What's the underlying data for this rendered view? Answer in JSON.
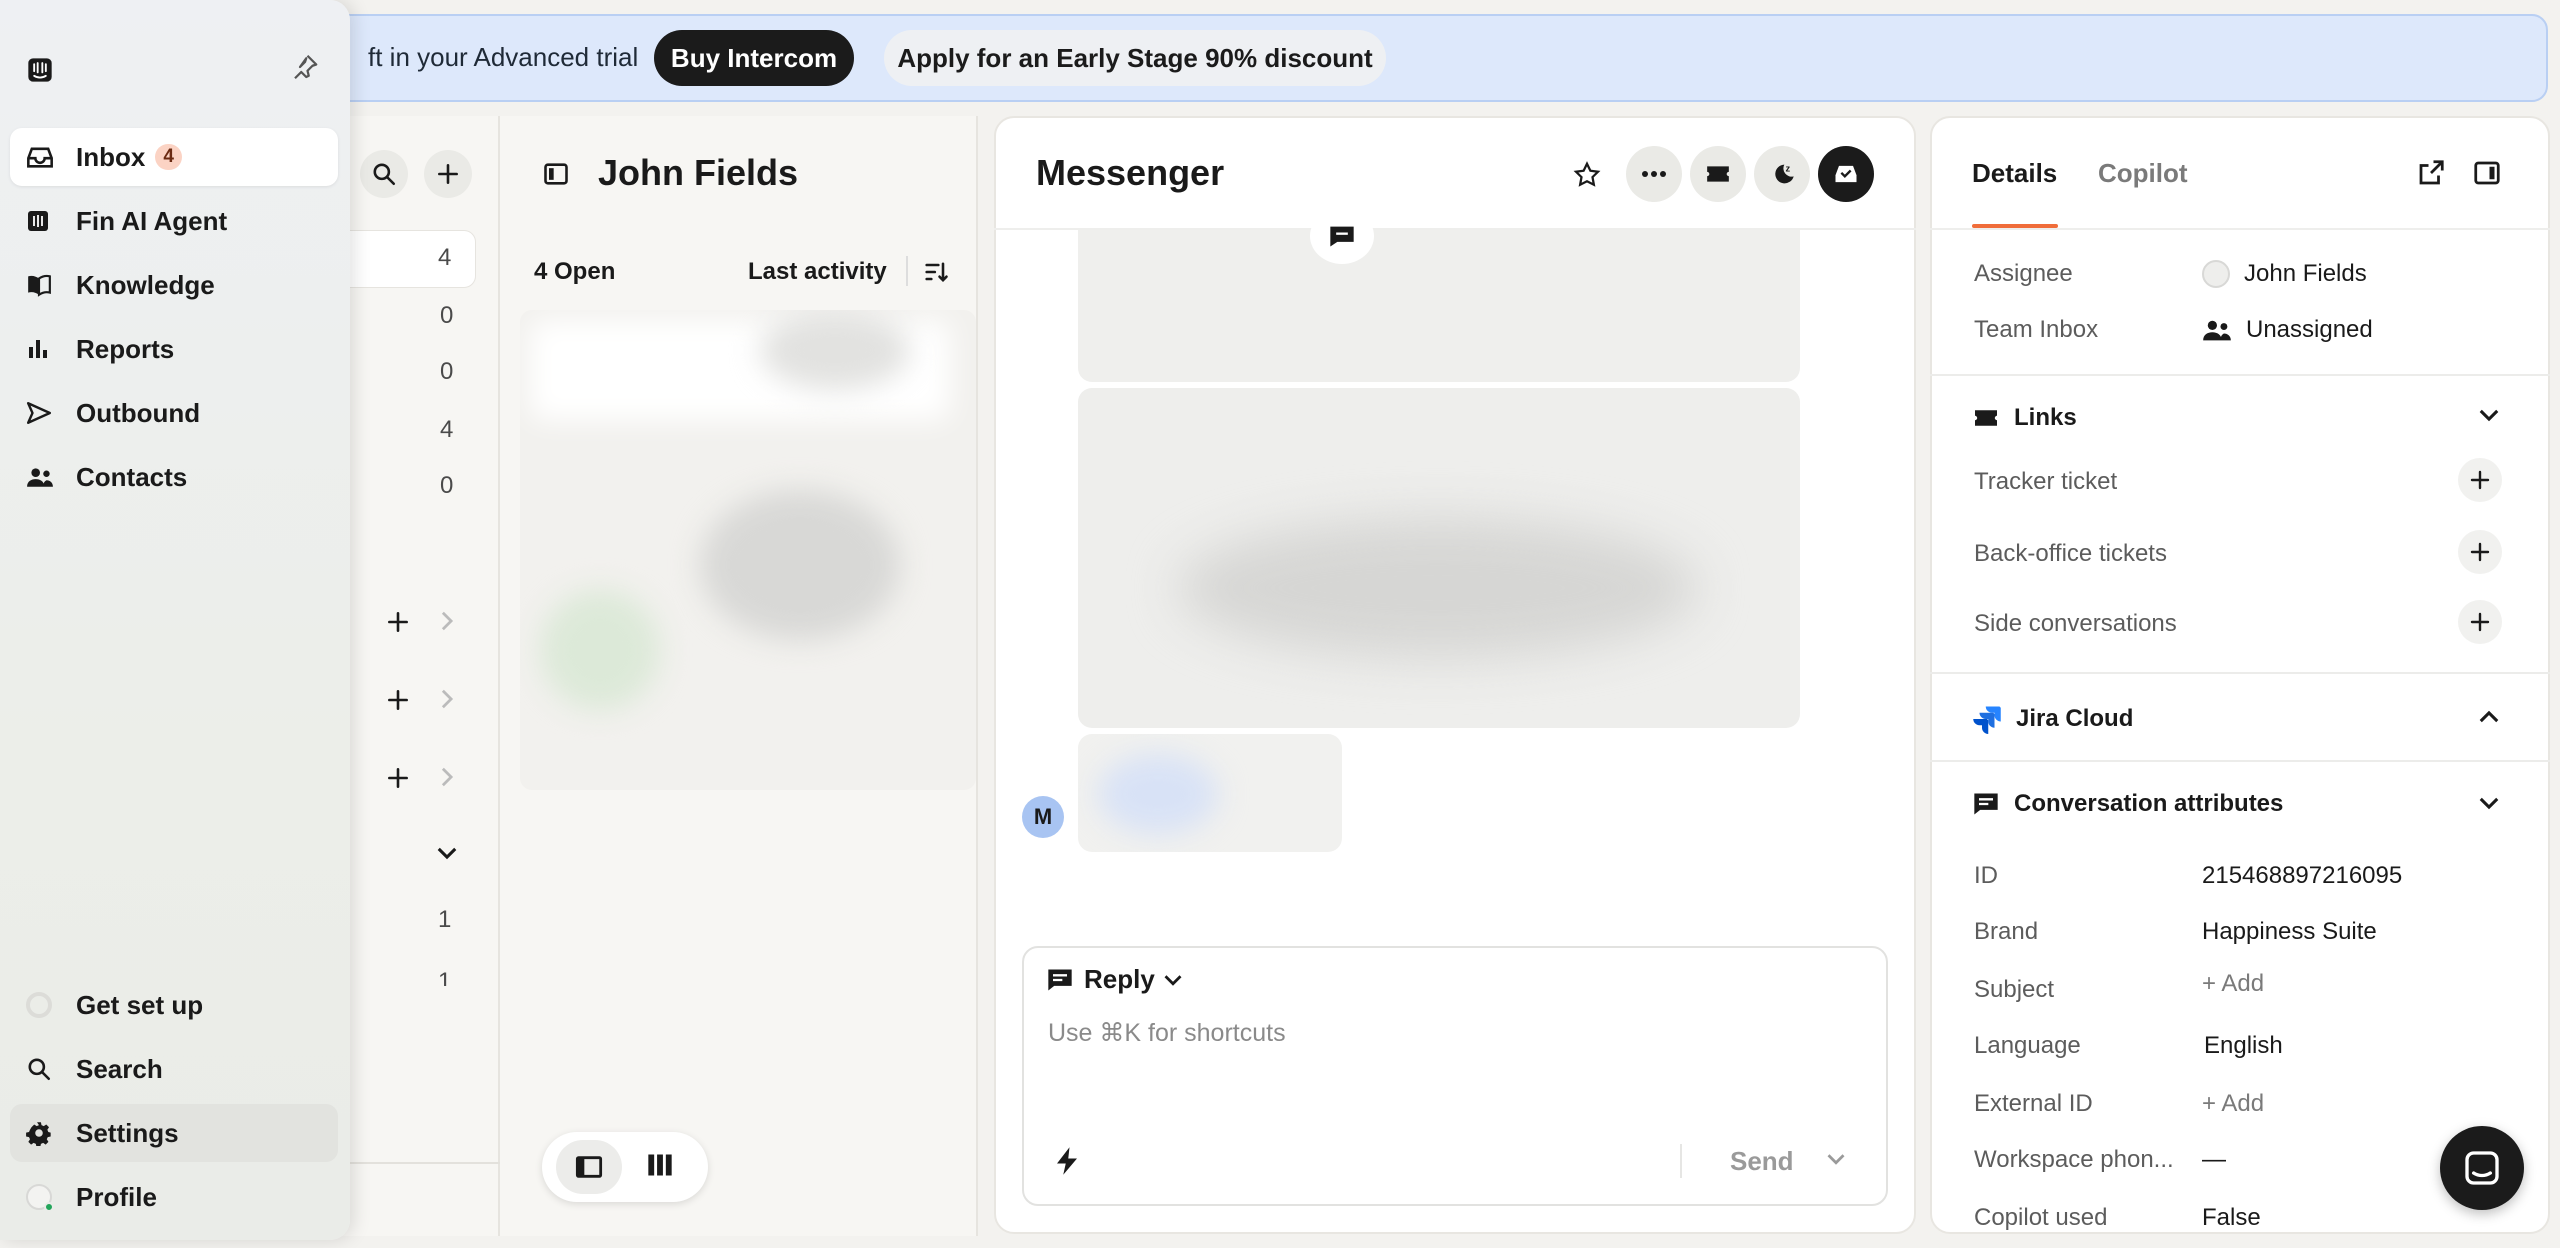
{
  "banner": {
    "text": "ft in your Advanced trial",
    "buy_label": "Buy Intercom",
    "discount_label": "Apply for an Early Stage 90% discount"
  },
  "nav": {
    "items": [
      {
        "label": "Inbox",
        "badge": "4",
        "icon": "inbox-icon"
      },
      {
        "label": "Fin AI Agent",
        "icon": "fin-icon"
      },
      {
        "label": "Knowledge",
        "icon": "book-icon"
      },
      {
        "label": "Reports",
        "icon": "bar-chart-icon"
      },
      {
        "label": "Outbound",
        "icon": "send-icon"
      },
      {
        "label": "Contacts",
        "icon": "people-icon"
      }
    ],
    "bottom": [
      {
        "label": "Get set up",
        "icon": "progress-icon"
      },
      {
        "label": "Search",
        "icon": "search-icon"
      },
      {
        "label": "Settings",
        "icon": "gear-icon"
      },
      {
        "label": "Profile",
        "icon": "avatar-icon"
      }
    ]
  },
  "inbox_list": {
    "counts": [
      "4",
      "0",
      "0",
      "4",
      "0"
    ],
    "lower_counts": [
      "1",
      "1"
    ]
  },
  "conv_list": {
    "title": "John Fields",
    "open_label": "4 Open",
    "sort_label": "Last activity"
  },
  "messenger": {
    "title": "Messenger",
    "avatar_letter": "M",
    "reply_label": "Reply",
    "composer_placeholder": "Use ⌘K for shortcuts",
    "send_label": "Send"
  },
  "details": {
    "tabs": [
      "Details",
      "Copilot"
    ],
    "assignee_label": "Assignee",
    "assignee_value": "John Fields",
    "team_label": "Team Inbox",
    "team_value": "Unassigned",
    "links_title": "Links",
    "links": [
      "Tracker ticket",
      "Back-office tickets",
      "Side conversations"
    ],
    "jira_title": "Jira Cloud",
    "attributes_title": "Conversation attributes",
    "attributes": [
      {
        "label": "ID",
        "value": "215468897216095"
      },
      {
        "label": "Brand",
        "value": "Happiness Suite"
      },
      {
        "label": "Subject",
        "value": "+ Add"
      },
      {
        "label": "Language",
        "value": "English"
      },
      {
        "label": "External ID",
        "value": "+ Add"
      },
      {
        "label": "Workspace phon...",
        "value": "—"
      },
      {
        "label": "Copilot used",
        "value": "False"
      }
    ]
  },
  "colors": {
    "accent": "#f06d3a",
    "banner_bg": "#dde8fb"
  }
}
